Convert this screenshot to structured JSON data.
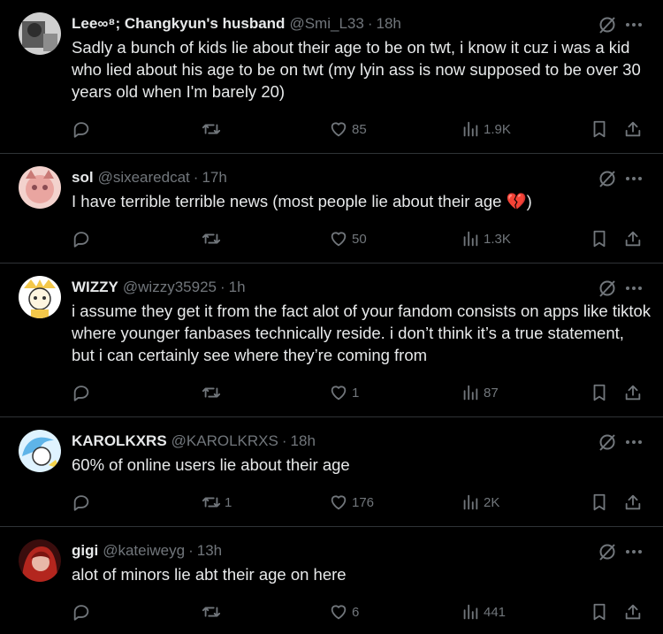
{
  "tweets": [
    {
      "name": "Lee∞⁸; Changkyun's husband",
      "handle": "@Smi_L33",
      "sep": "·",
      "time": "18h",
      "text": "Sadly a bunch of kids lie about their age to be on twt, i know it cuz i was a kid who lied about his age to be on twt (my lyin ass is now supposed to be over 30 years old when I'm barely 20)",
      "replies": "",
      "retweets": "",
      "likes": "85",
      "views": "1.9K",
      "avatar_colors": [
        "#5b5b5b",
        "#cfcfcf"
      ]
    },
    {
      "name": "sol",
      "handle": "@sixearedcat",
      "sep": "·",
      "time": "17h",
      "text": "I have terrible terrible news (most people lie about their age",
      "emoji": "💔",
      "text_end": ")",
      "replies": "",
      "retweets": "",
      "likes": "50",
      "views": "1.3K",
      "avatar_colors": [
        "#e9a5a0",
        "#8a4b52"
      ]
    },
    {
      "name": "WIZZY",
      "handle": "@wizzy35925",
      "sep": "·",
      "time": "1h",
      "text": "i assume they get it from the fact alot of your fandom consists on apps like tiktok where younger fanbases technically reside. i don’t think it’s a true statement, but i can certainly see where they’re coming from",
      "replies": "",
      "retweets": "",
      "likes": "1",
      "views": "87",
      "avatar_colors": [
        "#ffffff",
        "#f4c84a"
      ]
    },
    {
      "name": "KAROLKXRS",
      "handle": "@KAROLKRXS",
      "sep": "·",
      "time": "18h",
      "text": "60% of online users lie about their age",
      "replies": "",
      "retweets": "1",
      "likes": "176",
      "views": "2K",
      "avatar_colors": [
        "#dff3ff",
        "#5fb4e8"
      ]
    },
    {
      "name": "gigi",
      "handle": "@kateiweyg",
      "sep": "·",
      "time": "13h",
      "text": "alot of minors lie abt their age on here",
      "replies": "",
      "retweets": "",
      "likes": "6",
      "views": "441",
      "avatar_colors": [
        "#3a0d0d",
        "#b3261e"
      ]
    }
  ],
  "icons": {
    "reply": "reply-icon",
    "retweet": "retweet-icon",
    "like": "heart-icon",
    "views": "views-icon",
    "bookmark": "bookmark-icon",
    "share": "share-icon",
    "grok": "grok-icon",
    "more": "more-icon"
  },
  "colors": {
    "background": "#000000",
    "text": "#e7e9ea",
    "muted": "#71767b",
    "divider": "#2f3336"
  }
}
